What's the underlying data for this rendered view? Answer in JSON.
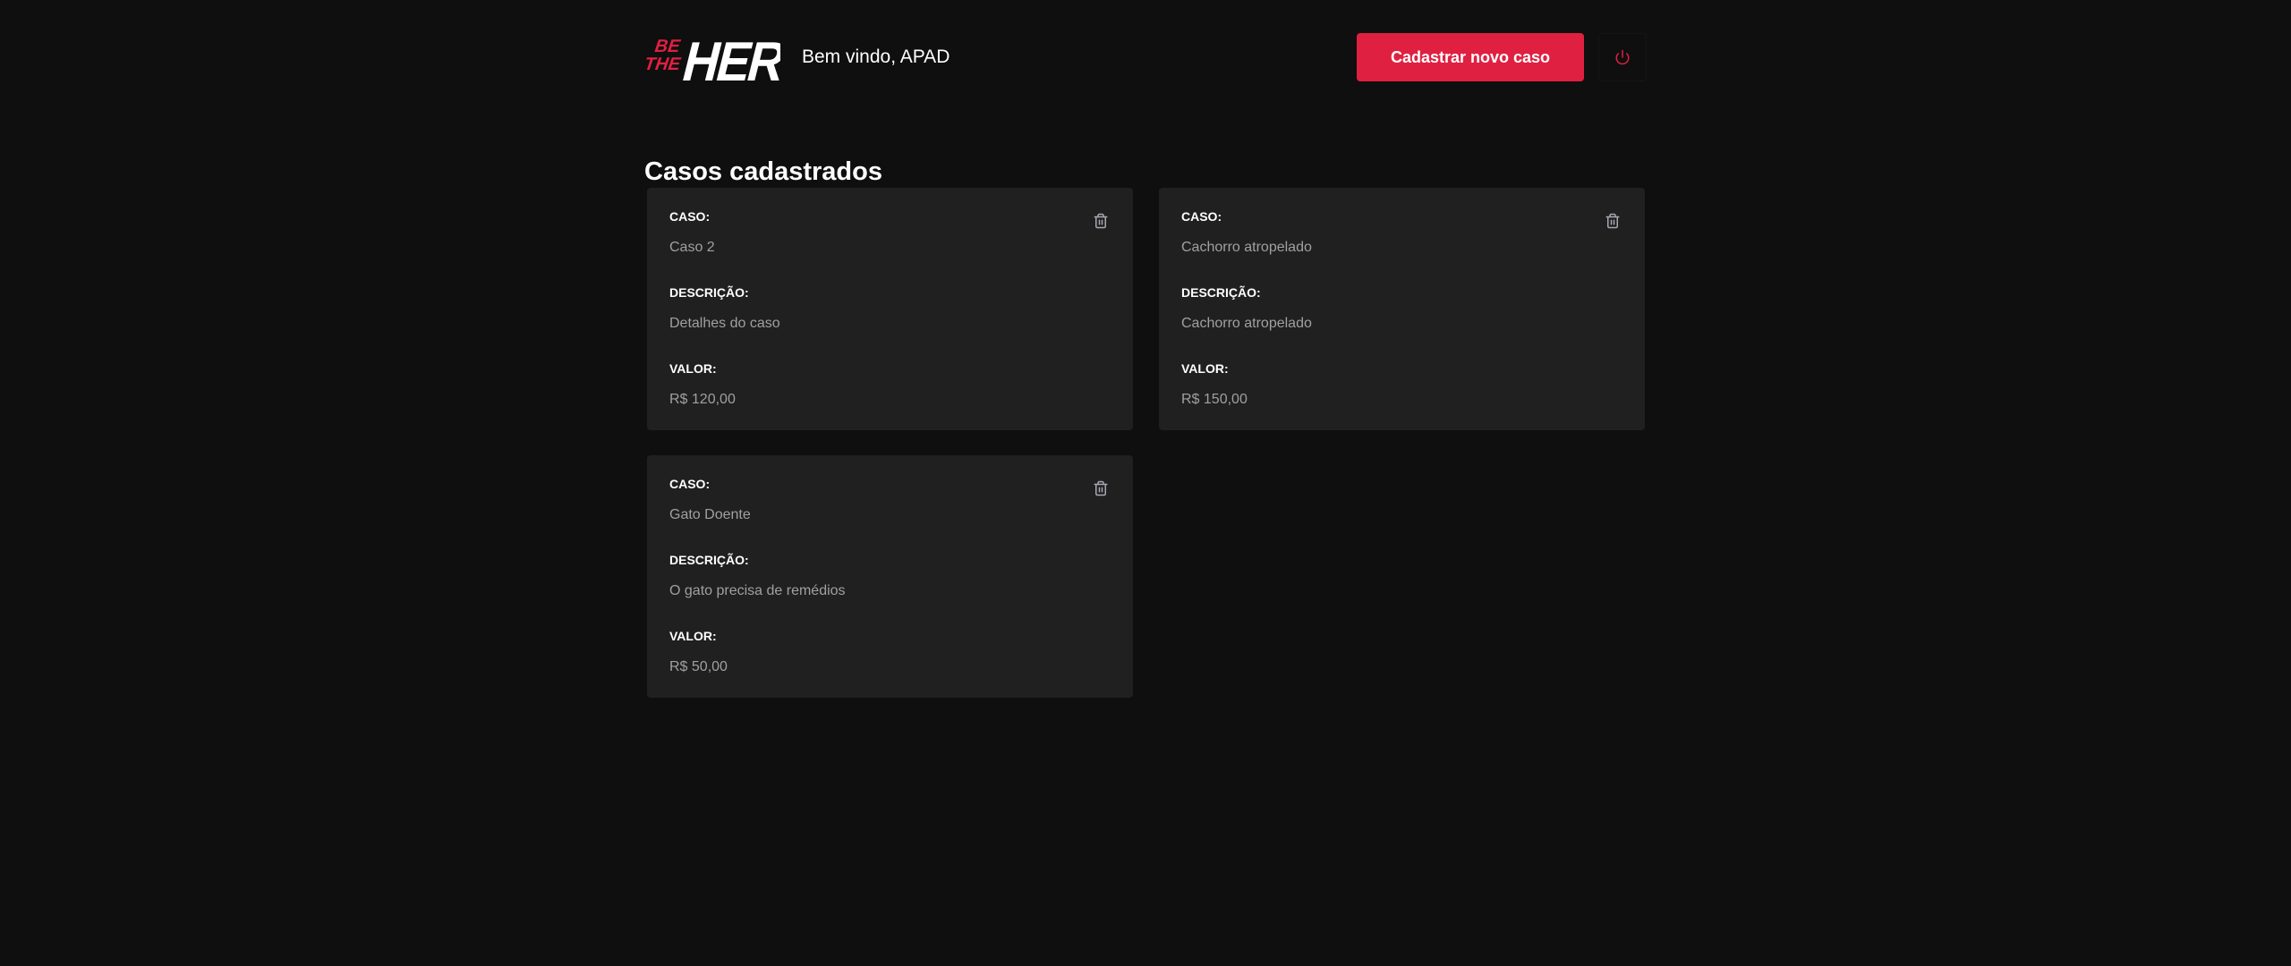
{
  "header": {
    "logo_text": "BE THE HERO",
    "welcome": "Bem vindo, APAD",
    "new_case_button": "Cadastrar novo caso"
  },
  "main": {
    "title": "Casos cadastrados"
  },
  "labels": {
    "case": "CASO:",
    "description": "DESCRIÇÃO:",
    "value": "VALOR:"
  },
  "cases": [
    {
      "title": "Caso 2",
      "description": "Detalhes do caso",
      "value": "R$ 120,00"
    },
    {
      "title": "Cachorro atropelado",
      "description": "Cachorro atropelado",
      "value": "R$ 150,00"
    },
    {
      "title": "Gato Doente",
      "description": "O gato precisa de remédios",
      "value": "R$ 50,00"
    }
  ],
  "colors": {
    "background": "#0f0f0f",
    "card": "#202020",
    "accent": "#e02041",
    "muted_text": "#a0a0a4"
  },
  "icons": {
    "logout": "power-icon",
    "delete": "trash-icon"
  }
}
